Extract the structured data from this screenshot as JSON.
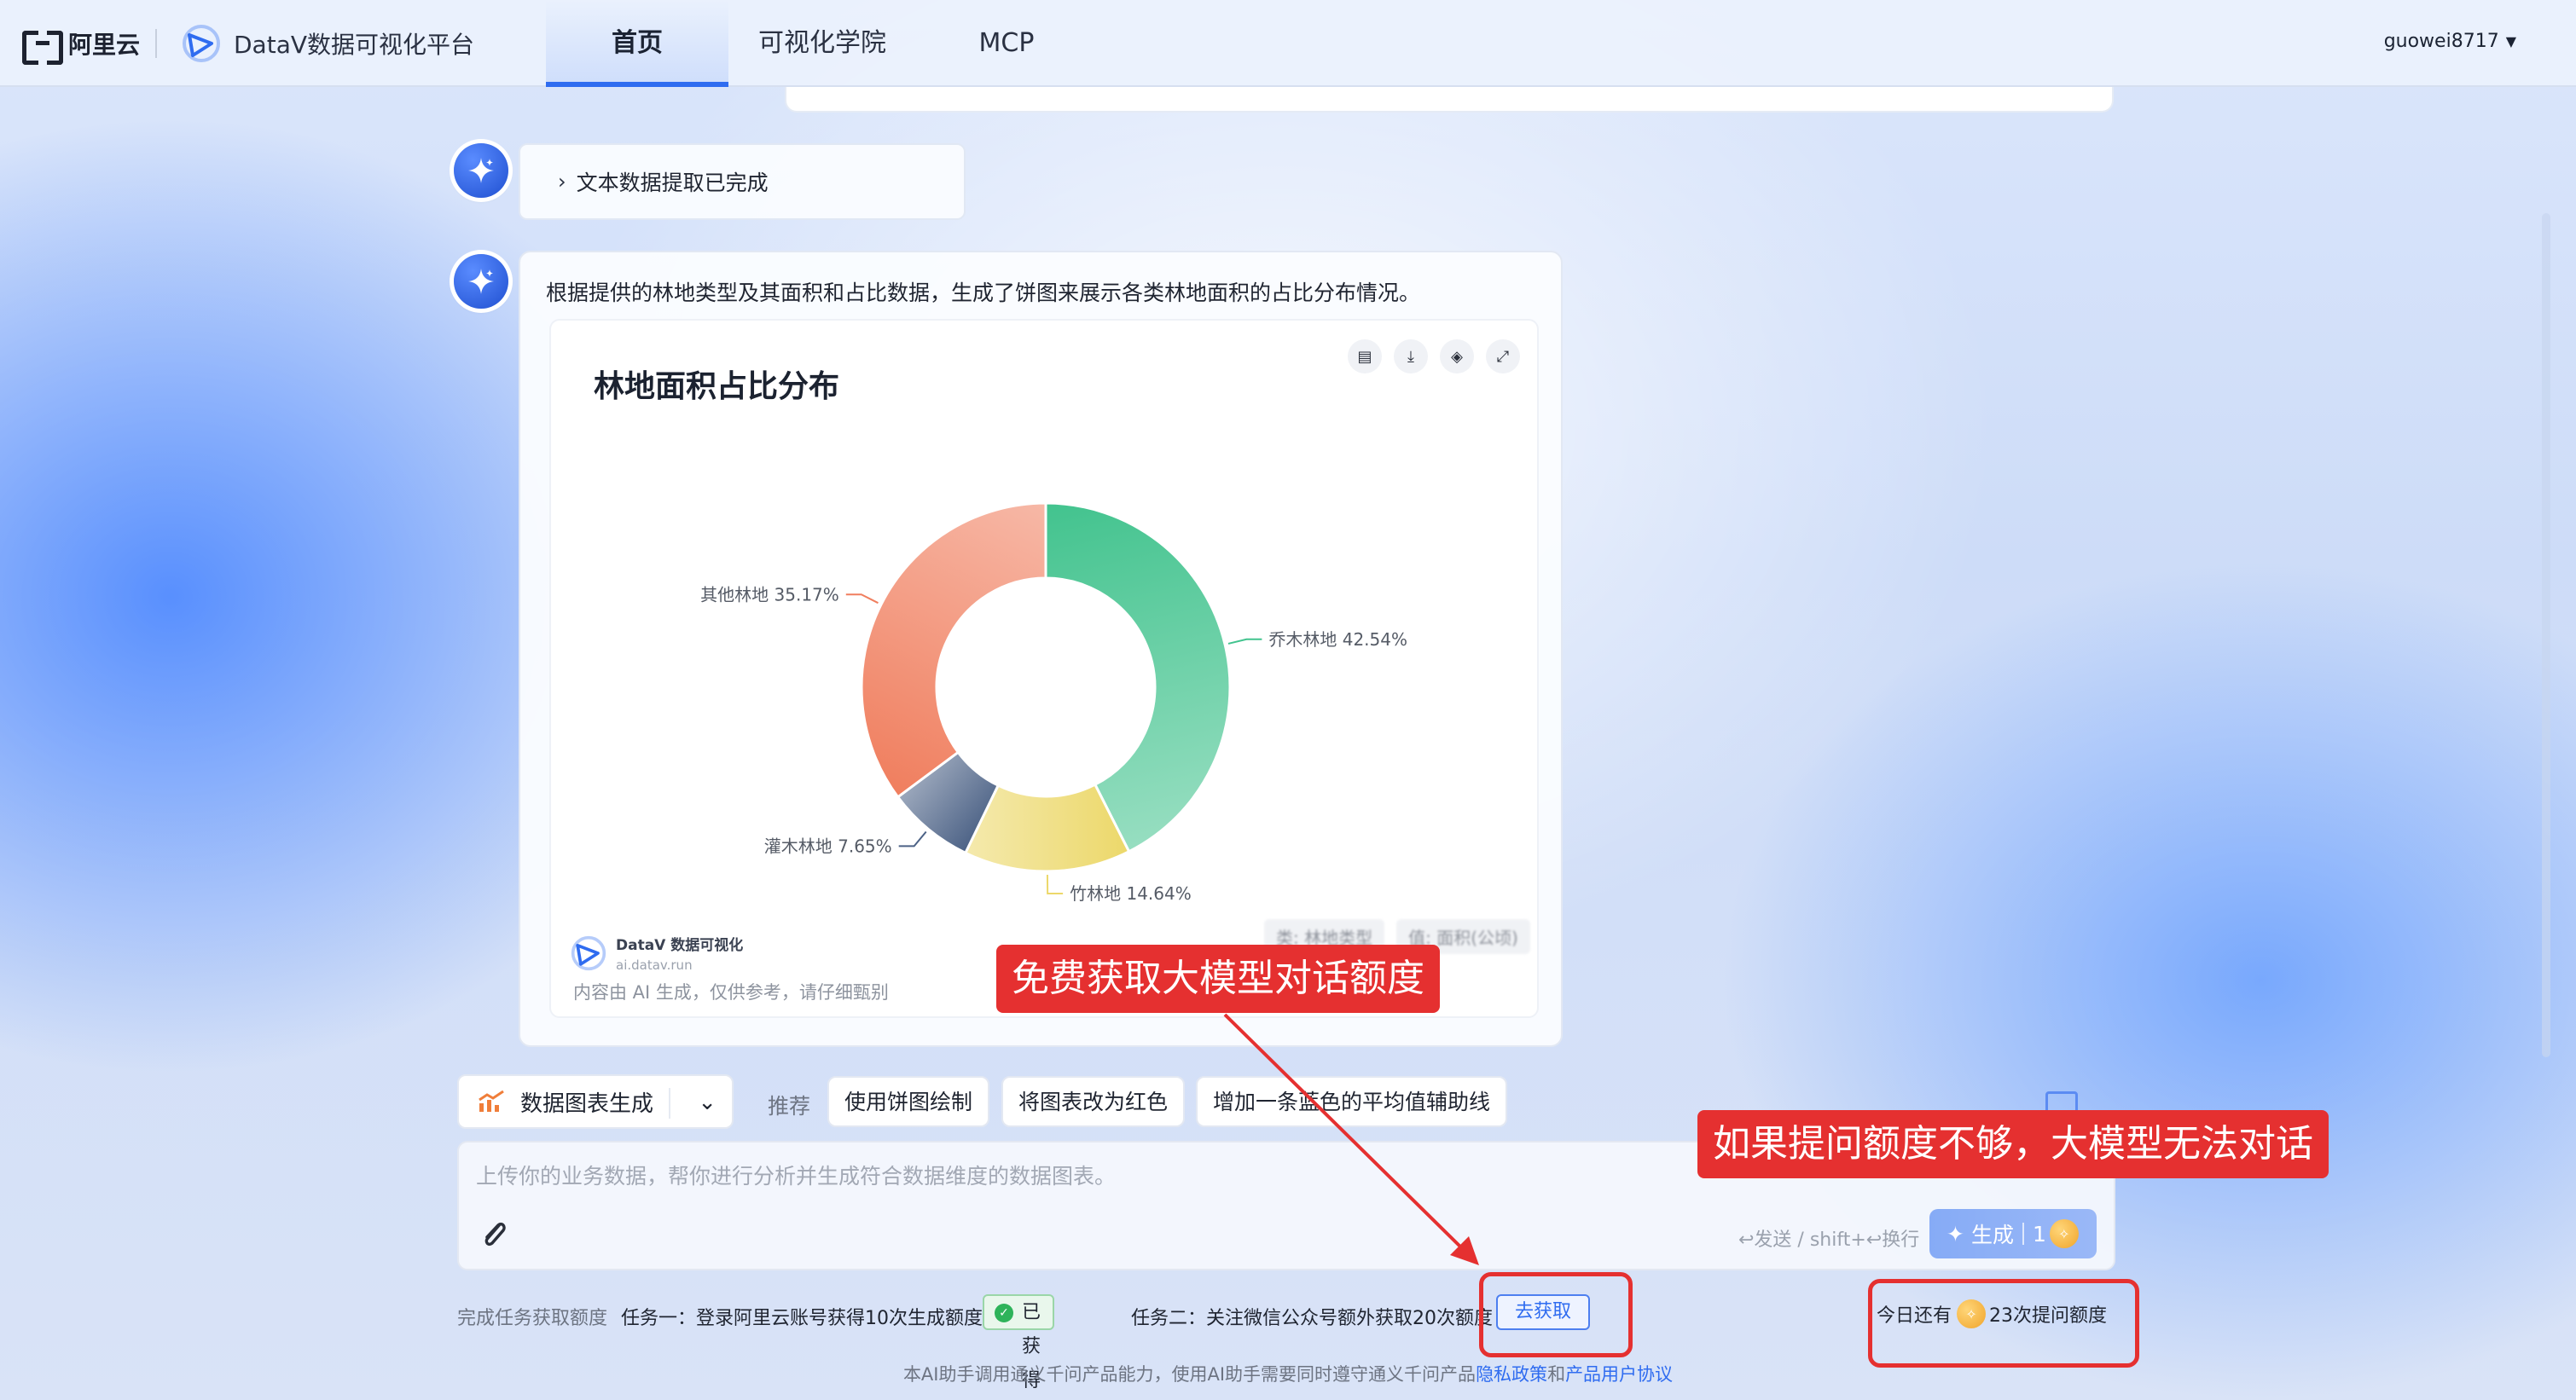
{
  "header": {
    "aliyun_brand": "阿里云",
    "platform_name": "DataV数据可视化平台",
    "tabs": [
      {
        "label": "首页",
        "active": true
      },
      {
        "label": "可视化学院",
        "active": false
      },
      {
        "label": "MCP",
        "active": false
      }
    ],
    "username": "guowei8717"
  },
  "conversation": {
    "status_message": "文本数据提取已完成",
    "answer_text": "根据提供的林地类型及其面积和占比数据，生成了饼图来展示各类林地面积的占比分布情况。",
    "disclaimer": "内容由 AI 生成，仅供参考，请仔细甄别",
    "watermark_name": "DataV 数据可视化",
    "watermark_url": "ai.datav.run",
    "legend_hint": [
      "类: 林地类型",
      "值: 面积(公顷)"
    ]
  },
  "chart_data": {
    "type": "pie",
    "title": "林地面积占比分布",
    "donut": true,
    "slices": [
      {
        "label": "乔木林地",
        "value": 42.54,
        "display": "乔木林地 42.54%",
        "color": "#42c38e"
      },
      {
        "label": "竹林地",
        "value": 14.64,
        "display": "竹林地 14.64%",
        "color": "#ecd86a"
      },
      {
        "label": "灌木林地",
        "value": 7.65,
        "display": "灌木林地 7.65%",
        "color": "#4c6286"
      },
      {
        "label": "其他林地",
        "value": 35.17,
        "display": "其他林地 35.17%",
        "color": "#f07e5e"
      }
    ]
  },
  "composer": {
    "mode_label": "数据图表生成",
    "suggest_label": "推荐",
    "suggestions": [
      "使用饼图绘制",
      "将图表改为红色",
      "增加一条蓝色的平均值辅助线"
    ],
    "input_placeholder": "上传你的业务数据，帮你进行分析并生成符合数据维度的数据图表。",
    "send_hint": "↩发送 / shift+↩换行",
    "generate_label": "生成",
    "generate_cost": "1"
  },
  "tasks": {
    "intro": "完成任务获取额度",
    "task1": "任务一：登录阿里云账号获得10次生成额度",
    "task1_status": "已获得",
    "task2": "任务二：关注微信公众号额外获取20次额度",
    "task2_button": "去获取",
    "quota_prefix": "今日还有",
    "quota_suffix": "23次提问额度"
  },
  "footer": {
    "note": "本AI助手调用通义千问产品能力，使用AI助手需要同时遵守通义千问产品",
    "privacy_link": "隐私政策",
    "and": "和",
    "agreement_link": "产品用户协议"
  },
  "annotations": {
    "free_quota": "免费获取大模型对话额度",
    "quota_warning": "如果提问额度不够，大模型无法对话"
  },
  "colors": {
    "accent": "#2f6cf0",
    "annotation_red": "#e53030"
  }
}
